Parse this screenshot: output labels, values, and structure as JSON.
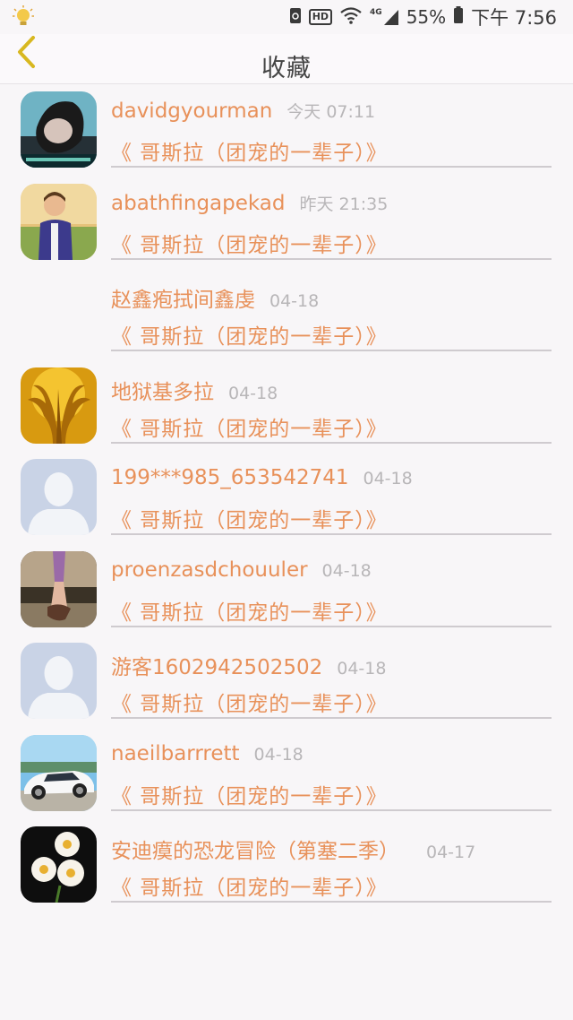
{
  "status_bar": {
    "network": "4G",
    "battery": "55%",
    "time": "下午 7:56",
    "icons": [
      "bulb-notification-icon",
      "sync-icon",
      "hd-icon",
      "wifi-icon",
      "signal-icon",
      "battery-icon"
    ]
  },
  "header": {
    "title": "收藏",
    "back_icon": "chevron-left-icon",
    "accent_color": "#d8b820"
  },
  "items": [
    {
      "username": "davidgyourman",
      "time": "今天 07:11",
      "title": "《 哥斯拉（团宠的一辈子）》",
      "avatar": "photo-portrait"
    },
    {
      "username": "abathfingapekad",
      "time": "昨天 21:35",
      "title": "《 哥斯拉（团宠的一辈子）》",
      "avatar": "photo-child"
    },
    {
      "username": "赵鑫疱拭间鑫虔",
      "time": "04-18",
      "title": "《 哥斯拉（团宠的一辈子）》",
      "avatar": "none"
    },
    {
      "username": "地狱基多拉",
      "time": "04-18",
      "title": "《 哥斯拉（团宠的一辈子）》",
      "avatar": "photo-golden-dragon"
    },
    {
      "username": "199***985_653542741",
      "time": "04-18",
      "title": "《 哥斯拉（团宠的一辈子）》",
      "avatar": "default-silhouette"
    },
    {
      "username": "proenzasdchouuler",
      "time": "04-18",
      "title": "《 哥斯拉（团宠的一辈子）》",
      "avatar": "photo-legs"
    },
    {
      "username": "游客1602942502502",
      "time": "04-18",
      "title": "《 哥斯拉（团宠的一辈子）》",
      "avatar": "default-silhouette"
    },
    {
      "username": "naeilbarrrett",
      "time": "04-18",
      "title": "《 哥斯拉（团宠的一辈子）》",
      "avatar": "photo-white-car"
    },
    {
      "username": "安迪瘼的恐龙冒险（第塞二季）",
      "time": "04-17",
      "title": "《 哥斯拉（团宠的一辈子）》",
      "avatar": "photo-daisies"
    }
  ],
  "colors": {
    "text_accent": "#e8915a",
    "time_gray": "#b8b6b8",
    "background": "#f8f6f8"
  }
}
